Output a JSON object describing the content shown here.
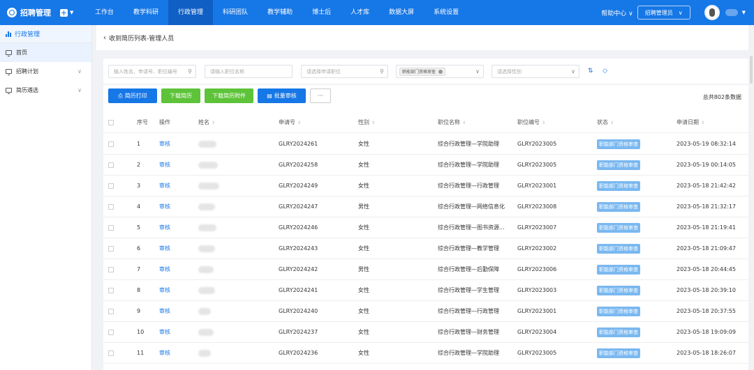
{
  "app": {
    "title": "招聘管理"
  },
  "topnav": {
    "items": [
      "工作台",
      "教学科研",
      "行政管理",
      "科研团队",
      "教学辅助",
      "博士后",
      "人才库",
      "数据大屏",
      "系统设置"
    ],
    "active_index": 2,
    "help_label": "帮助中心",
    "user_role": "招聘管理员"
  },
  "sidebar": {
    "header": "行政管理",
    "items": [
      {
        "label": "首页",
        "active": true
      },
      {
        "label": "招聘计划",
        "expandable": true
      },
      {
        "label": "简历遴选",
        "expandable": true
      }
    ]
  },
  "breadcrumb": {
    "text": "收到简历列表-管理人员"
  },
  "filters": {
    "name_placeholder": "输入姓名、申请号、职位编号",
    "position_name_placeholder": "请输入职位名称",
    "apply_position_placeholder": "请选择申请职位",
    "status_tag": "职能部门资格审查",
    "gender_placeholder": "请选择性别"
  },
  "toolbar": {
    "print_label": "简历打印",
    "download_label": "下载简历",
    "download_attach_label": "下载简历附件",
    "batch_review_label": "批量审核",
    "more_label": "···",
    "total_text": "总共802条数据"
  },
  "columns": [
    "序号",
    "操作",
    "姓名",
    "申请号",
    "性别",
    "职位名称",
    "职位编号",
    "状态",
    "申请日期"
  ],
  "rows": [
    {
      "index": "1",
      "action": "审核",
      "apply_no": "GLRY2024261",
      "gender": "女性",
      "position": "综合行政管理—学院助理",
      "position_no": "GLRY2023005",
      "status": "职能部门资格审查",
      "date": "2023-05-19 08:32:14"
    },
    {
      "index": "2",
      "action": "审核",
      "apply_no": "GLRY2024258",
      "gender": "女性",
      "position": "综合行政管理—学院助理",
      "position_no": "GLRY2023005",
      "status": "职能部门资格审查",
      "date": "2023-05-19 00:14:05"
    },
    {
      "index": "3",
      "action": "审核",
      "apply_no": "GLRY2024249",
      "gender": "女性",
      "position": "综合行政管理—行政管理",
      "position_no": "GLRY2023001",
      "status": "职能部门资格审查",
      "date": "2023-05-18 21:42:42"
    },
    {
      "index": "4",
      "action": "审核",
      "apply_no": "GLRY2024247",
      "gender": "男性",
      "position": "综合行政管理—网络信息化",
      "position_no": "GLRY2023008",
      "status": "职能部门资格审查",
      "date": "2023-05-18 21:32:17"
    },
    {
      "index": "5",
      "action": "审核",
      "apply_no": "GLRY2024246",
      "gender": "女性",
      "position": "综合行政管理—图书资源...",
      "position_no": "GLRY2023007",
      "status": "职能部门资格审查",
      "date": "2023-05-18 21:19:41"
    },
    {
      "index": "6",
      "action": "审核",
      "apply_no": "GLRY2024243",
      "gender": "女性",
      "position": "综合行政管理—教学管理",
      "position_no": "GLRY2023002",
      "status": "职能部门资格审查",
      "date": "2023-05-18 21:09:47"
    },
    {
      "index": "7",
      "action": "审核",
      "apply_no": "GLRY2024242",
      "gender": "男性",
      "position": "综合行政管理—后勤保障",
      "position_no": "GLRY2023006",
      "status": "职能部门资格审查",
      "date": "2023-05-18 20:44:45"
    },
    {
      "index": "8",
      "action": "审核",
      "apply_no": "GLRY2024241",
      "gender": "女性",
      "position": "综合行政管理—学生管理",
      "position_no": "GLRY2023003",
      "status": "职能部门资格审查",
      "date": "2023-05-18 20:39:10"
    },
    {
      "index": "9",
      "action": "审核",
      "apply_no": "GLRY2024240",
      "gender": "女性",
      "position": "综合行政管理—行政管理",
      "position_no": "GLRY2023001",
      "status": "职能部门资格审查",
      "date": "2023-05-18 20:37:55"
    },
    {
      "index": "10",
      "action": "审核",
      "apply_no": "GLRY2024237",
      "gender": "女性",
      "position": "综合行政管理—财务管理",
      "position_no": "GLRY2023004",
      "status": "职能部门资格审查",
      "date": "2023-05-18 19:09:09"
    },
    {
      "index": "11",
      "action": "审核",
      "apply_no": "GLRY2024236",
      "gender": "女性",
      "position": "综合行政管理—学院助理",
      "position_no": "GLRY2023005",
      "status": "职能部门资格审查",
      "date": "2023-05-18 18:26:07"
    }
  ]
}
